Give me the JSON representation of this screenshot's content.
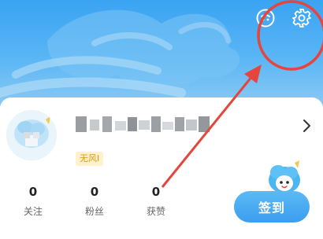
{
  "profile": {
    "badge_label": "无风I"
  },
  "stats": [
    {
      "value": "0",
      "label": "关注"
    },
    {
      "value": "0",
      "label": "粉丝"
    },
    {
      "value": "0",
      "label": "获赞"
    }
  ],
  "checkin": {
    "label": "签到"
  },
  "icons": {
    "top_left": "message-icon",
    "top_right": "gear-icon",
    "chevron": "chevron-right-icon"
  },
  "colors": {
    "header": "#3aa3f2",
    "accent": "#3b9def",
    "badge_bg": "#fff1c9",
    "badge_text": "#d89a12",
    "annotation": "#e5453c"
  }
}
